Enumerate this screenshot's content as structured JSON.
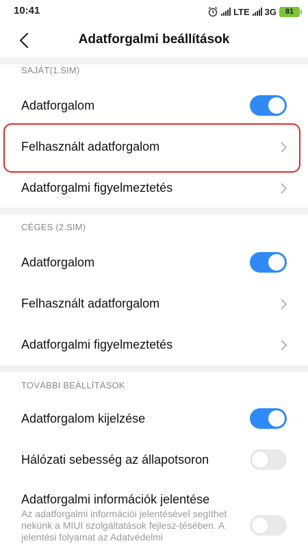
{
  "status": {
    "time": "10:41",
    "network1": "LTE",
    "network2": "3G",
    "battery": "81"
  },
  "header": {
    "title": "Adatforgalmi beállítások"
  },
  "sim1": {
    "section": "SAJÁT(1.SIM)",
    "data": "Adatforgalom",
    "used": "Felhasznált adatforgalom",
    "warning": "Adatforgalmi figyelmeztetés"
  },
  "sim2": {
    "section": "CÉGES (2.SIM)",
    "data": "Adatforgalom",
    "used": "Felhasznált adatforgalom",
    "warning": "Adatforgalmi figyelmeztetés"
  },
  "more": {
    "section": "TOVÁBBI BEÁLLÍTÁSOK",
    "show_usage": "Adatforgalom kijelzése",
    "speed": "Hálózati sebesség az állapotsoron",
    "report": "Adatforgalmi információk jelentése",
    "report_desc": "Az adatforgalmi információi jelentésével segíthet nekünk a MIUI szolgáltatások fejlesz-tésében. A jelentési folyamat az Adatvédelmi"
  },
  "colors": {
    "accent": "#2f8af5",
    "highlight": "#e02a2a",
    "battery": "#7ec43b"
  }
}
